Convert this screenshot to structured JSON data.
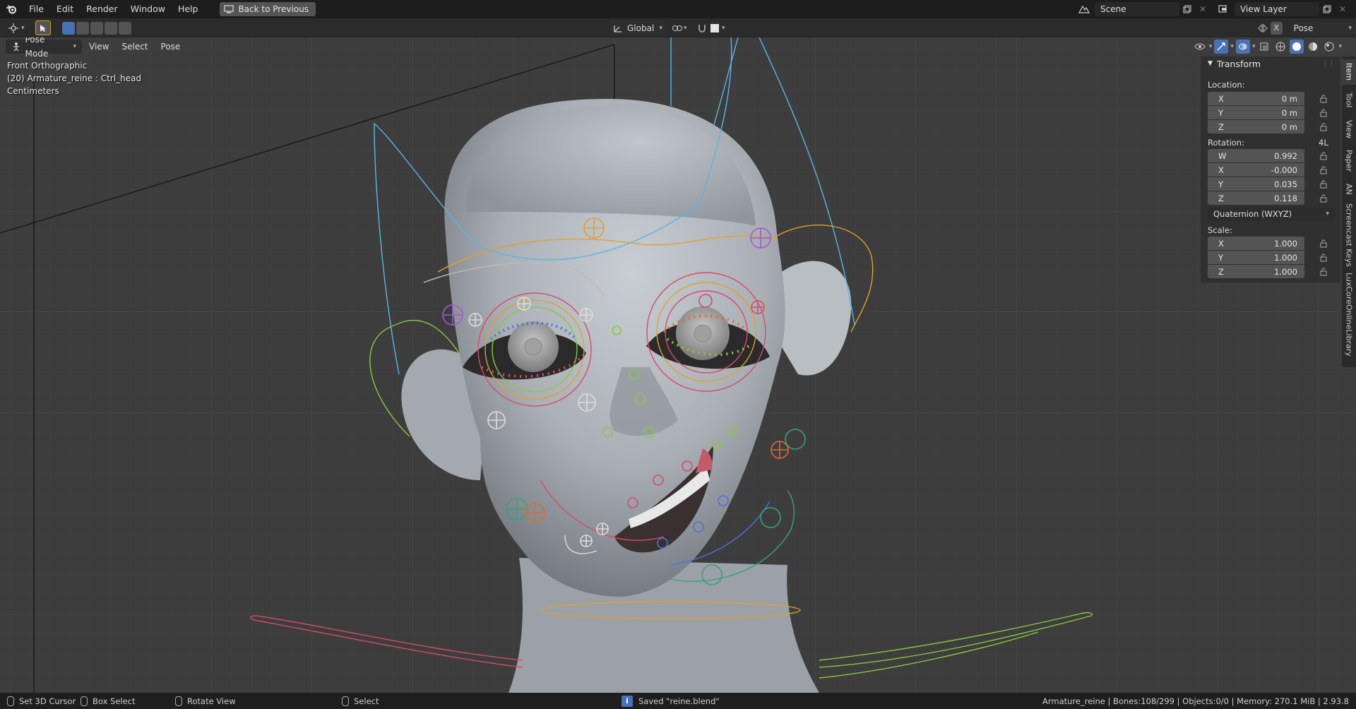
{
  "app": {
    "name": "Blender",
    "version": "2.93.8"
  },
  "menu": {
    "file": "File",
    "edit": "Edit",
    "render": "Render",
    "window": "Window",
    "help": "Help"
  },
  "back_button": "Back to Previous",
  "scene": {
    "name": "Scene",
    "view_layer": "View Layer"
  },
  "header": {
    "orientation": "Global",
    "pose_options": "Pose Options",
    "x_toggle": "X"
  },
  "viewport_header": {
    "mode": "Pose Mode",
    "view": "View",
    "select": "Select",
    "pose": "Pose"
  },
  "viewport_info": {
    "view_name": "Front Orthographic",
    "object_bone": "(20) Armature_reine : Ctrl_head",
    "units": "Centimeters"
  },
  "transform_panel": {
    "title": "Transform",
    "location_label": "Location:",
    "location": [
      {
        "axis": "X",
        "value": "0 m"
      },
      {
        "axis": "Y",
        "value": "0 m"
      },
      {
        "axis": "Z",
        "value": "0 m"
      }
    ],
    "rotation_label": "Rotation:",
    "rotation_lock_label": "4L",
    "rotation": [
      {
        "axis": "W",
        "value": "0.992"
      },
      {
        "axis": "X",
        "value": "-0.000"
      },
      {
        "axis": "Y",
        "value": "0.035"
      },
      {
        "axis": "Z",
        "value": "0.118"
      }
    ],
    "rotation_mode": "Quaternion (WXYZ)",
    "scale_label": "Scale:",
    "scale": [
      {
        "axis": "X",
        "value": "1.000"
      },
      {
        "axis": "Y",
        "value": "1.000"
      },
      {
        "axis": "Z",
        "value": "1.000"
      }
    ]
  },
  "sidebar_tabs": [
    "Item",
    "Tool",
    "View",
    "Paper",
    "AN",
    "Screencast Keys",
    "LuxCoreOnlineLibrary"
  ],
  "statusbar": {
    "set_cursor": "Set 3D Cursor",
    "box_select": "Box Select",
    "rotate_view": "Rotate View",
    "select": "Select",
    "message": "Saved \"reine.blend\"",
    "stats": "Armature_reine | Bones:108/299 | Objects:0/0 | Memory: 270.1 MiB | 2.93.8"
  },
  "colors": {
    "accent_blue": "#4772b3",
    "viewport_bg": "#3d3d3d",
    "topbar_bg": "#1d1d1d"
  }
}
